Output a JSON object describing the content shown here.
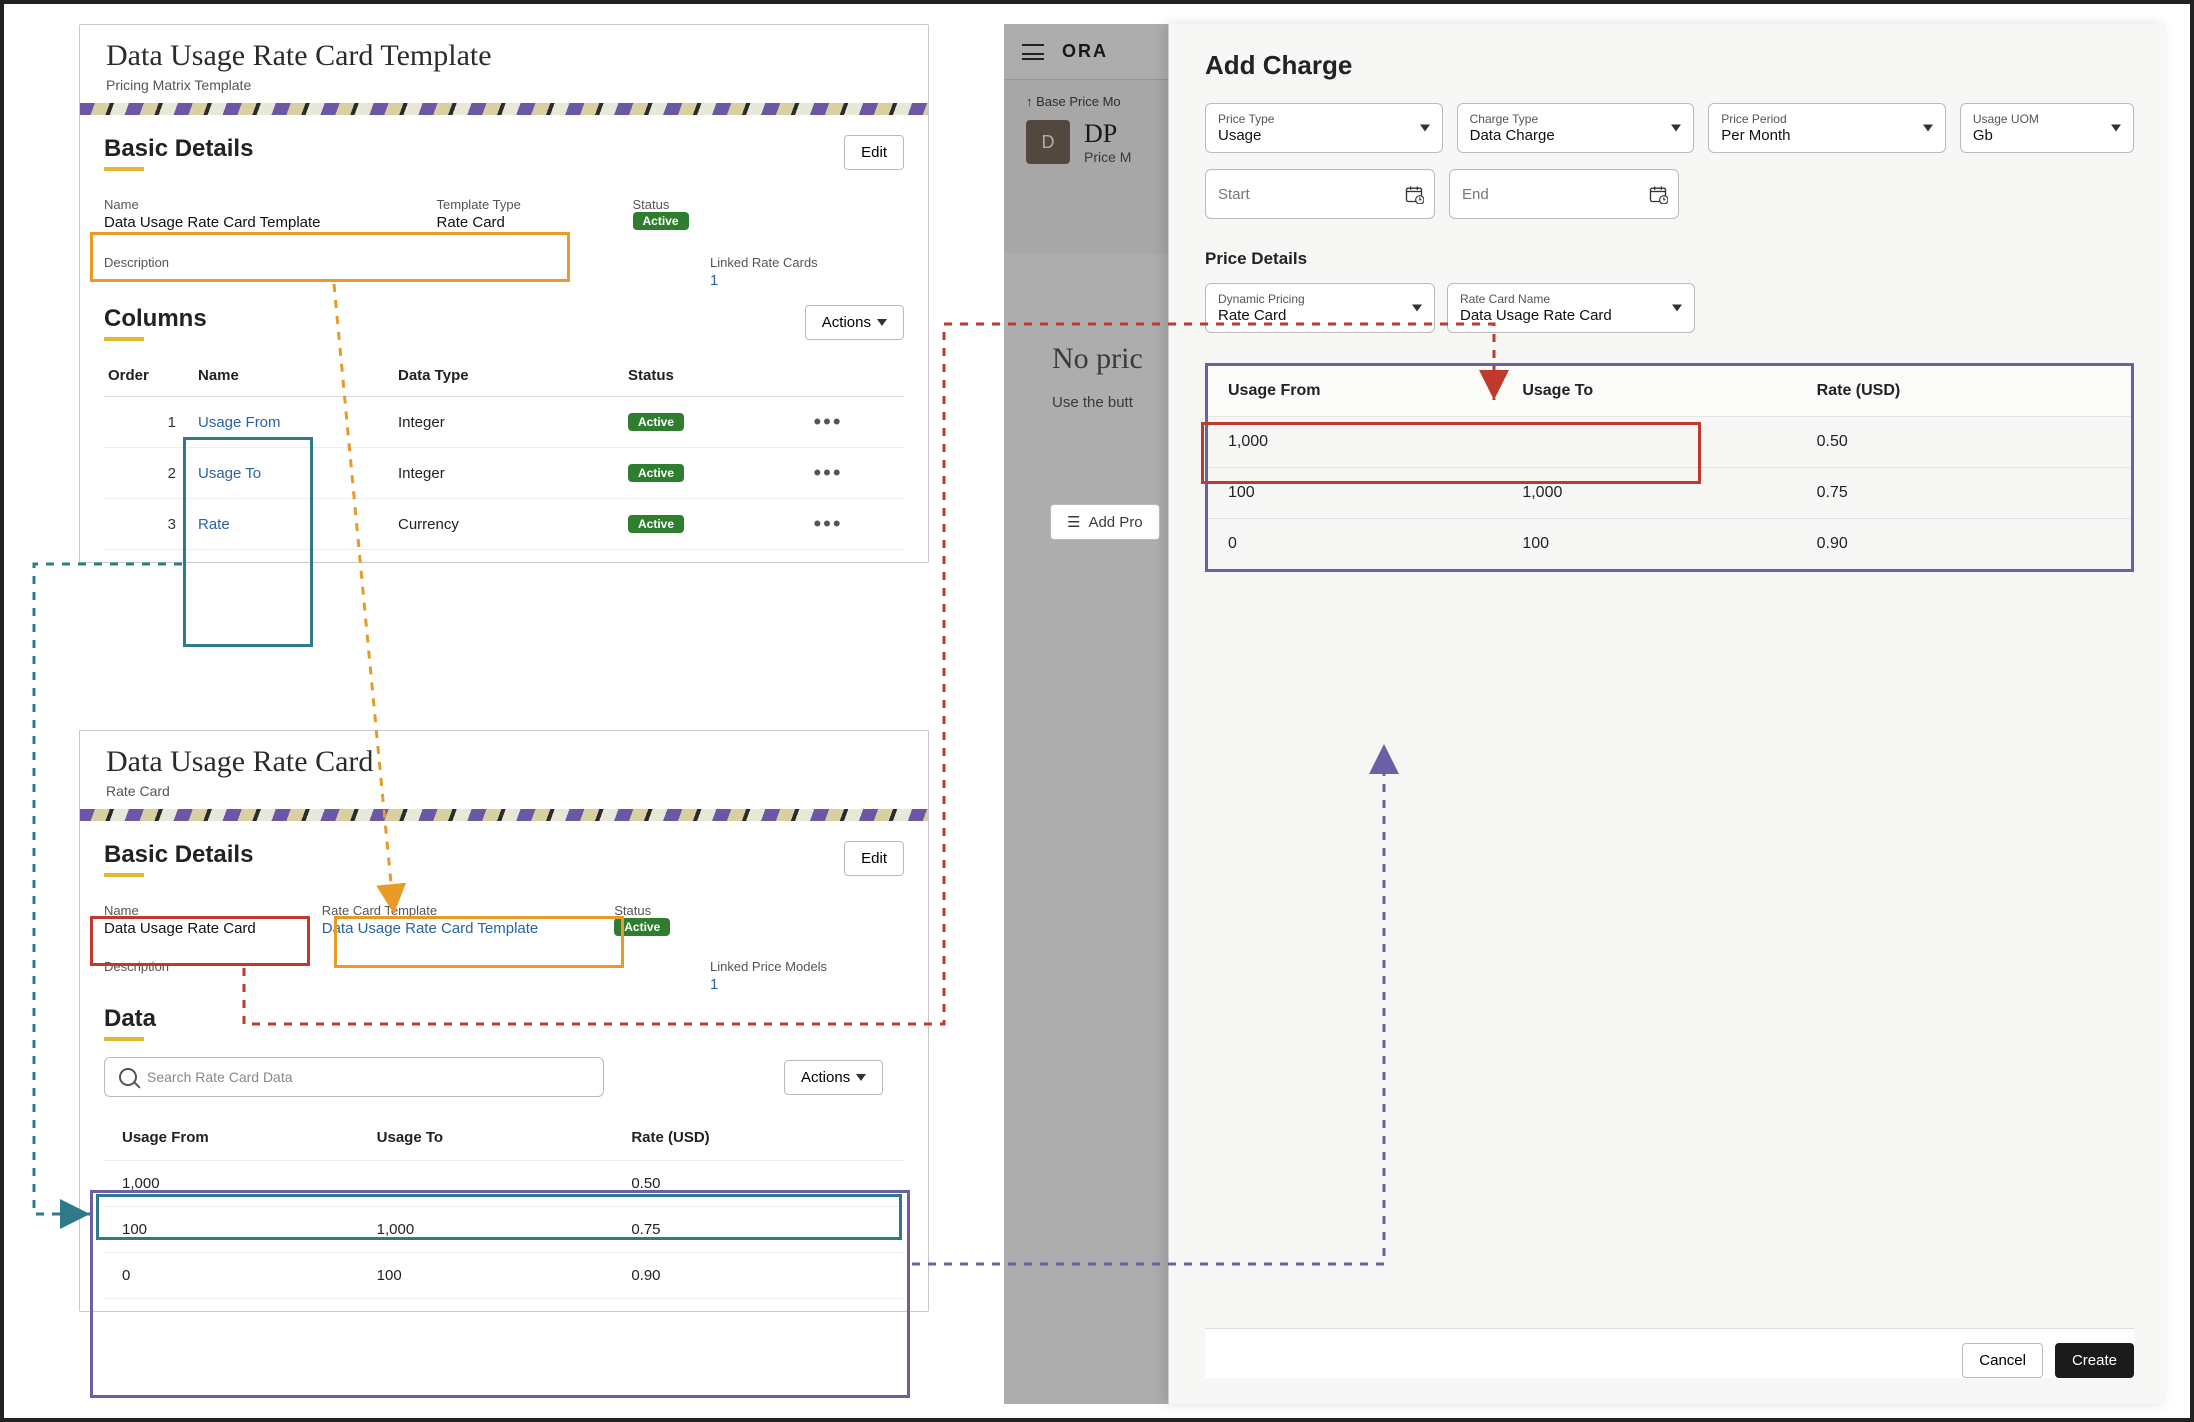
{
  "template": {
    "title": "Data Usage Rate Card Template",
    "subtitle": "Pricing Matrix Template",
    "basic_details_label": "Basic Details",
    "edit_label": "Edit",
    "name_label": "Name",
    "name_value": "Data Usage Rate Card Template",
    "template_type_label": "Template Type",
    "template_type_value": "Rate Card",
    "status_label": "Status",
    "status_value": "Active",
    "description_label": "Description",
    "linked_label": "Linked Rate Cards",
    "linked_value": "1",
    "columns_label": "Columns",
    "actions_label": "Actions",
    "columns_headers": {
      "order": "Order",
      "name": "Name",
      "datatype": "Data Type",
      "status": "Status"
    },
    "columns": [
      {
        "order": "1",
        "name": "Usage From",
        "datatype": "Integer",
        "status": "Active"
      },
      {
        "order": "2",
        "name": "Usage To",
        "datatype": "Integer",
        "status": "Active"
      },
      {
        "order": "3",
        "name": "Rate",
        "datatype": "Currency",
        "status": "Active"
      }
    ]
  },
  "ratecard": {
    "title": "Data Usage Rate Card",
    "subtitle": "Rate Card",
    "basic_details_label": "Basic Details",
    "edit_label": "Edit",
    "name_label": "Name",
    "name_value": "Data Usage Rate Card",
    "template_label": "Rate Card Template",
    "template_value": "Data Usage Rate Card Template",
    "status_label": "Status",
    "status_value": "Active",
    "description_label": "Description",
    "linked_label": "Linked Price Models",
    "linked_value": "1",
    "data_label": "Data",
    "search_placeholder": "Search Rate Card Data",
    "actions_label": "Actions",
    "headers": {
      "c1": "Usage From",
      "c2": "Usage To",
      "c3": "Rate (USD)"
    },
    "rows": [
      {
        "c1": "1,000",
        "c2": "",
        "c3": "0.50"
      },
      {
        "c1": "100",
        "c2": "1,000",
        "c3": "0.75"
      },
      {
        "c1": "0",
        "c2": "100",
        "c3": "0.90"
      }
    ]
  },
  "bg": {
    "brand": "ORA",
    "breadcrumb": "Base Price Mo",
    "dp_badge": "D",
    "dp_title": "DP",
    "dp_sub": "Price M",
    "no_price": "No pric",
    "use_btn": "Use the butt",
    "add_pro": "Add Pro"
  },
  "drawer": {
    "title": "Add Charge",
    "price_type_label": "Price Type",
    "price_type_value": "Usage",
    "charge_type_label": "Charge Type",
    "charge_type_value": "Data Charge",
    "price_period_label": "Price Period",
    "price_period_value": "Per Month",
    "usage_uom_label": "Usage UOM",
    "usage_uom_value": "Gb",
    "start_label": "Start",
    "end_label": "End",
    "price_details_label": "Price Details",
    "dyn_pricing_label": "Dynamic Pricing",
    "dyn_pricing_value": "Rate Card",
    "rc_name_label": "Rate Card Name",
    "rc_name_value": "Data Usage Rate Card",
    "headers": {
      "c1": "Usage From",
      "c2": "Usage To",
      "c3": "Rate (USD)"
    },
    "rows": [
      {
        "c1": "1,000",
        "c2": "",
        "c3": "0.50"
      },
      {
        "c1": "100",
        "c2": "1,000",
        "c3": "0.75"
      },
      {
        "c1": "0",
        "c2": "100",
        "c3": "0.90"
      }
    ],
    "cancel_label": "Cancel",
    "create_label": "Create"
  }
}
